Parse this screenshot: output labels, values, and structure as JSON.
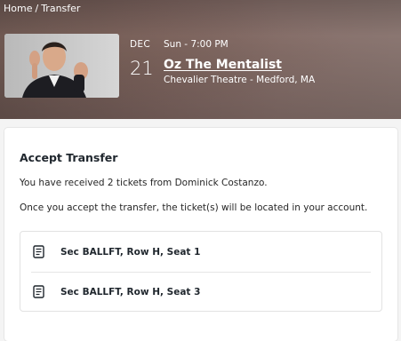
{
  "breadcrumb": {
    "home": "Home",
    "separator": "/",
    "current": "Transfer"
  },
  "event": {
    "month": "DEC",
    "day": "21",
    "time": "Sun - 7:00 PM",
    "title": "Oz The Mentalist",
    "venue": "Chevalier Theatre - Medford, MA"
  },
  "transfer": {
    "heading": "Accept Transfer",
    "message": "You have received 2 tickets from Dominick Costanzo.",
    "note": "Once you accept the transfer, the ticket(s) will be located in your account.",
    "tickets": [
      {
        "label": "Sec BALLFT, Row H, Seat 1",
        "icon": "ticket-document-icon"
      },
      {
        "label": "Sec BALLFT, Row H, Seat 3",
        "icon": "ticket-document-icon"
      }
    ]
  }
}
